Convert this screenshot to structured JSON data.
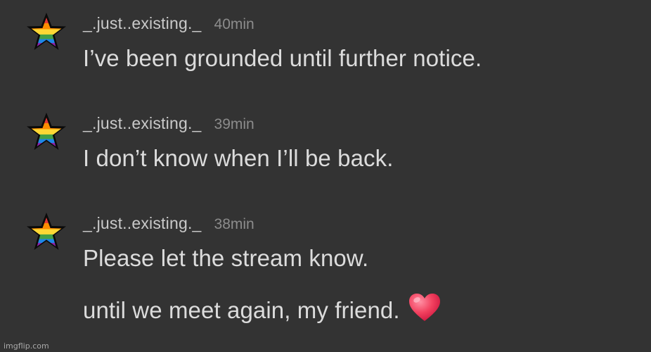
{
  "comments": [
    {
      "username": "_.just..existing._",
      "time": "40min",
      "messages": [
        "I’ve been grounded until further notice."
      ],
      "avatar_icon": "rainbow-star-icon"
    },
    {
      "username": "_.just..existing._",
      "time": "39min",
      "messages": [
        "I don’t know when I’ll be back."
      ],
      "avatar_icon": "rainbow-star-icon"
    },
    {
      "username": "_.just..existing._",
      "time": "38min",
      "messages": [
        "Please let the stream know.",
        "until we meet again, my friend."
      ],
      "avatar_icon": "rainbow-star-icon"
    }
  ],
  "heart_icon": "red-heart-icon",
  "colors": {
    "background": "#333333",
    "username": "#c9c9c9",
    "time": "#8c8c8c",
    "message": "#dcdcdc",
    "heart": "#f2415f"
  },
  "watermark": "imgflip.com"
}
